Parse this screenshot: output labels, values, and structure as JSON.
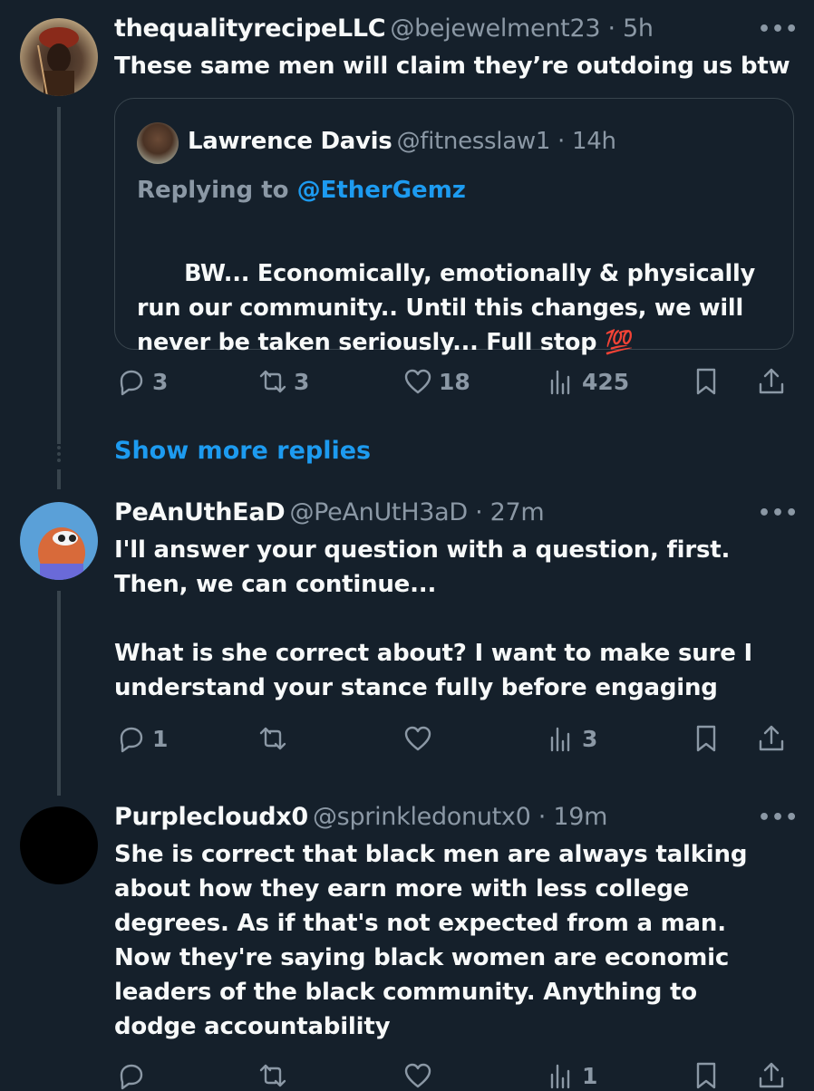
{
  "thread": [
    {
      "author_name": "thequalityrecipeLLC",
      "handle_time": "@bejewelment23 · 5h",
      "text": "These same men will claim they’re outdoing us btw",
      "more": "•••",
      "quote": {
        "author_name": "Lawrence Davis",
        "handle_time": "@fitnesslaw1 · 14h",
        "replying_prefix": "Replying to ",
        "replying_handle": "@EtherGemz",
        "text": "BW... Economically, emotionally & physically\nrun our community.. Until this changes, we will\nnever be taken seriously... Full stop ",
        "emoji": "💯"
      },
      "actions": {
        "replies": "3",
        "reposts": "3",
        "likes": "18",
        "views": "425"
      }
    },
    {
      "author_name": "PeAnUthEaD",
      "handle_time": "@PeAnUtH3aD · 27m",
      "text": "I'll answer your question with a question, first.\nThen, we can continue...\n\nWhat is she correct about? I want to make sure I\nunderstand your stance fully before engaging",
      "more": "•••",
      "actions": {
        "replies": "1",
        "reposts": "",
        "likes": "",
        "views": "3"
      }
    },
    {
      "author_name": "Purplecloudx0",
      "handle_time": "@sprinkledonutx0 · 19m",
      "text": "She is correct that black men are always talking\nabout how they earn more with less college\ndegrees. As if that's not expected from a man.\nNow they're saying black women are economic\nleaders of the black community. Anything to\ndodge accountability",
      "more": "•••",
      "actions": {
        "replies": "",
        "reposts": "",
        "likes": "",
        "views": "1"
      }
    }
  ],
  "show_more_replies": "Show more replies",
  "icons": {
    "reply": "reply-icon",
    "repost": "repost-icon",
    "like": "heart-icon",
    "views": "views-icon",
    "bookmark": "bookmark-icon",
    "share": "share-icon"
  },
  "colors": {
    "background": "#15202b",
    "text": "#f7f9f9",
    "secondary": "#8b98a5",
    "accent": "#1d9bf0",
    "border": "#38444d"
  }
}
